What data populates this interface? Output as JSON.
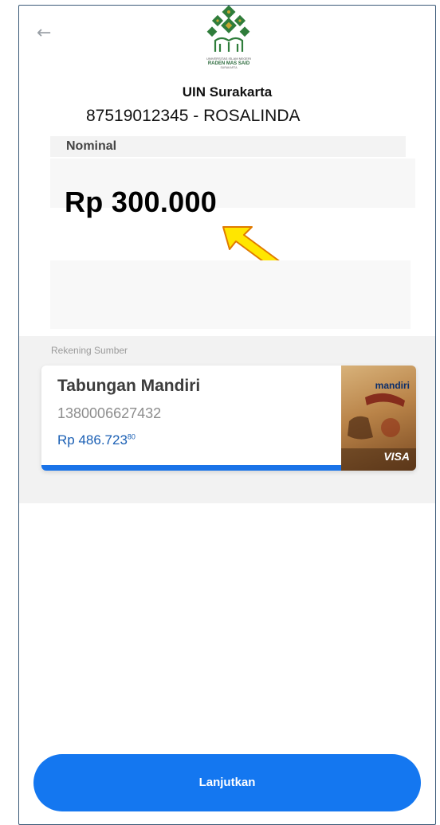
{
  "header": {
    "back_icon": "arrow-left-icon",
    "logo": {
      "line1": "UNIVERSITAS ISLAM NEGERI",
      "line2": "RADEN MAS SAID",
      "line3": "SURAKARTA"
    },
    "institution": "UIN Surakarta",
    "account_line": "87519012345 - ROSALINDA"
  },
  "nominal": {
    "label": "Nominal",
    "amount": "Rp 300.000",
    "highlight_arrow_color": "#ffe600"
  },
  "source": {
    "label": "Rekening Sumber",
    "card": {
      "name": "Tabungan Mandiri",
      "number": "1380006627432",
      "balance_main": "Rp 486.723",
      "balance_cents": "80",
      "brand": "mandiri",
      "network": "VISA"
    }
  },
  "footer": {
    "continue_label": "Lanjutkan",
    "button_color": "#1477f0"
  }
}
